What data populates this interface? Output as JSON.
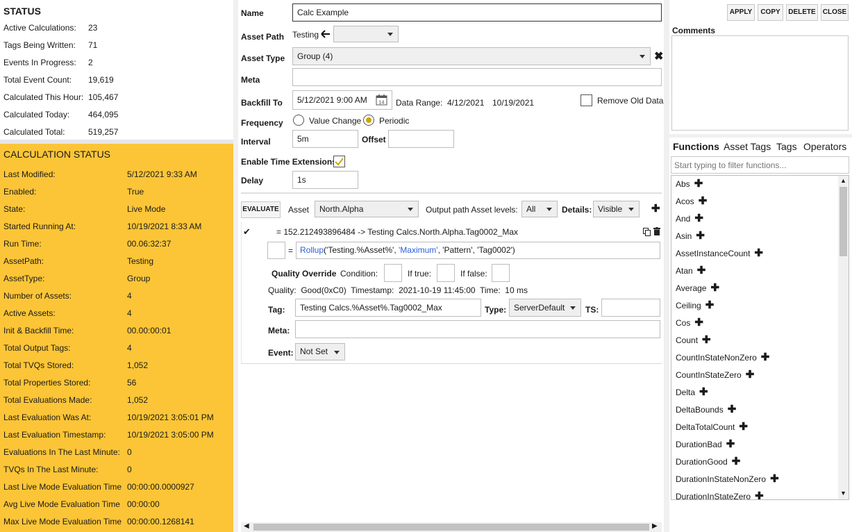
{
  "status": {
    "title": "STATUS",
    "rows": [
      {
        "label": "Active Calculations:",
        "value": "23"
      },
      {
        "label": "Tags Being Written:",
        "value": "71"
      },
      {
        "label": "Events In Progress:",
        "value": "2"
      },
      {
        "label": "Total Event Count:",
        "value": "19,619"
      },
      {
        "label": "Calculated This Hour:",
        "value": "105,467"
      },
      {
        "label": "Calculated Today:",
        "value": "464,095"
      },
      {
        "label": "Calculated Total:",
        "value": "519,257"
      }
    ]
  },
  "calc_status": {
    "title": "CALCULATION STATUS",
    "rows": [
      {
        "label": "Last Modified:",
        "value": "5/12/2021 9:33 AM"
      },
      {
        "label": "Enabled:",
        "value": "True"
      },
      {
        "label": "State:",
        "value": "Live Mode"
      },
      {
        "label": "Started Running At:",
        "value": "10/19/2021 8:33 AM"
      },
      {
        "label": "Run Time:",
        "value": "00.06:32:37"
      },
      {
        "label": "AssetPath:",
        "value": "Testing"
      },
      {
        "label": "AssetType:",
        "value": "Group"
      },
      {
        "label": "Number of Assets:",
        "value": "4"
      },
      {
        "label": "Active Assets:",
        "value": "4"
      },
      {
        "label": "Init & Backfill Time:",
        "value": "00.00:00:01"
      },
      {
        "label": "Total Output Tags:",
        "value": "4"
      },
      {
        "label": "Total TVQs Stored:",
        "value": "1,052"
      },
      {
        "label": "Total Properties Stored:",
        "value": "56"
      },
      {
        "label": "Total Evaluations Made:",
        "value": "1,052"
      },
      {
        "label": "Last Evaluation Was At:",
        "value": "10/19/2021 3:05:01 PM"
      },
      {
        "label": "Last Evaluation Timestamp:",
        "value": "10/19/2021 3:05:00 PM"
      },
      {
        "label": "Evaluations In The Last Minute:",
        "value": "0"
      },
      {
        "label": "TVQs In The Last Minute:",
        "value": "0"
      },
      {
        "label": "Last Live Mode Evaluation Time",
        "value": "00:00:00.0000927"
      },
      {
        "label": "Avg Live Mode Evaluation Time",
        "value": "00:00:00"
      },
      {
        "label": "Max Live Mode Evaluation Time",
        "value": "00:00:00.1268141"
      }
    ]
  },
  "form": {
    "name_label": "Name",
    "name_value": "Calc Example",
    "asset_path_label": "Asset Path",
    "asset_path_value": "Testing",
    "asset_type_label": "Asset Type",
    "asset_type_value": "Group (4)",
    "meta_label": "Meta",
    "backfill_label": "Backfill To",
    "backfill_value": "5/12/2021 9:00 AM",
    "data_range_label": "Data Range:",
    "data_range_start": "4/12/2021",
    "data_range_end": "10/19/2021",
    "remove_old_label": "Remove Old Data",
    "frequency_label": "Frequency",
    "freq_value_change": "Value Change",
    "freq_periodic": "Periodic",
    "interval_label": "Interval",
    "interval_value": "5m",
    "offset_label": "Offset",
    "enable_ext_label": "Enable Time Extensions",
    "delay_label": "Delay",
    "delay_value": "1s"
  },
  "eval_bar": {
    "evaluate_label": "EVALUATE",
    "asset_label": "Asset",
    "asset_value": "North.Alpha",
    "output_label": "Output path Asset levels:",
    "output_value": "All",
    "details_label": "Details:",
    "details_value": "Visible"
  },
  "expression": {
    "result": "= 152.212493896484 -> Testing Calcs.North.Alpha.Tag0002_Max",
    "equals": "=",
    "func": "Rollup",
    "args_open": "('Testing.%Asset%', ",
    "arg_max": "'Maximum'",
    "args_rest": ", 'Pattern', 'Tag0002')",
    "quality_override_label": "Quality Override",
    "condition_label": "Condition:",
    "if_true_label": "If true:",
    "if_false_label": "If false:",
    "quality_line": "Quality:  Good(0xC0)  Timestamp:  2021-10-19 11:45:00  Time:  10 ms",
    "tag_label": "Tag:",
    "tag_value": "Testing Calcs.%Asset%.Tag0002_Max",
    "type_label": "Type:",
    "type_value": "ServerDefault",
    "ts_label": "TS:",
    "meta_label": "Meta:",
    "event_label": "Event:",
    "event_value": "Not Set"
  },
  "actions": {
    "apply": "APPLY",
    "copy": "COPY",
    "delete": "DELETE",
    "close": "CLOSE",
    "comments_label": "Comments"
  },
  "functions_panel": {
    "tabs": [
      "Functions",
      "Asset Tags",
      "Tags",
      "Operators"
    ],
    "filter_placeholder": "Start typing to filter functions...",
    "items": [
      "Abs",
      "Acos",
      "And",
      "Asin",
      "AssetInstanceCount",
      "Atan",
      "Average",
      "Ceiling",
      "Cos",
      "Count",
      "CountInStateNonZero",
      "CountInStateZero",
      "Delta",
      "DeltaBounds",
      "DeltaTotalCount",
      "DurationBad",
      "DurationGood",
      "DurationInStateNonZero",
      "DurationInStateZero"
    ]
  },
  "colors": {
    "calc_status_bg": "#fcc537",
    "link_blue": "#2b5fd9",
    "check_gold": "#c9a800"
  }
}
